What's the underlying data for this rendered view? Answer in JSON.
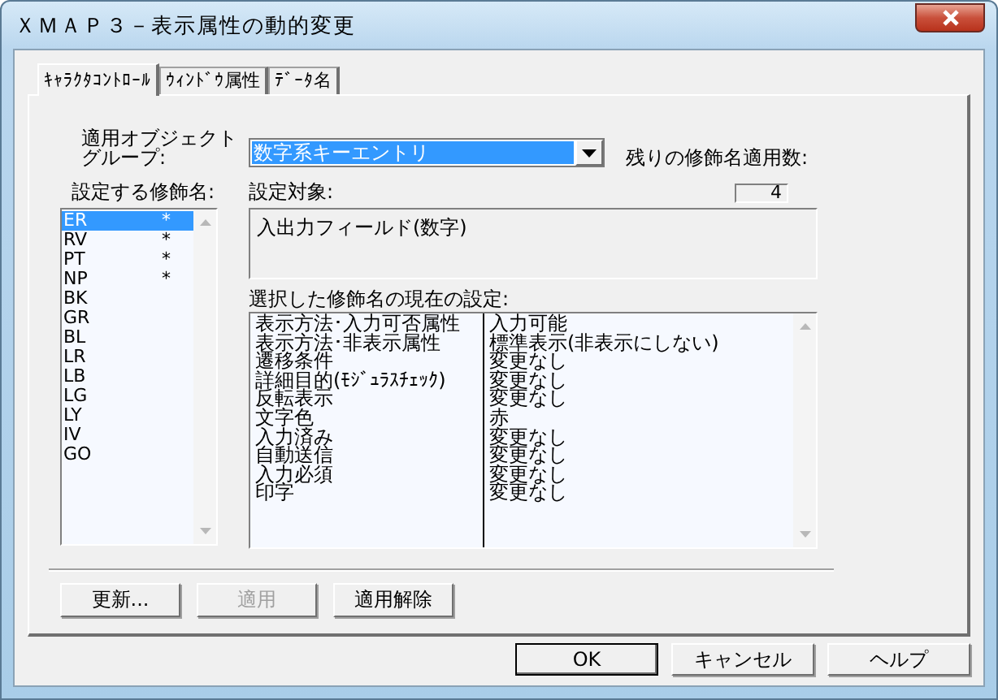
{
  "window": {
    "title": "ＸＭＡＰ３－表示属性の動的変更"
  },
  "tabs": [
    {
      "label": "ｷｬﾗｸﾀｺﾝﾄﾛｰﾙ",
      "selected": true
    },
    {
      "label": "ｳｨﾝﾄﾞｳ属性",
      "selected": false
    },
    {
      "label": "ﾃﾞｰﾀ名",
      "selected": false
    }
  ],
  "object_group": {
    "label": "適用オブジェクトグループ:",
    "value": "数字系キーエントリ"
  },
  "remaining": {
    "label": "残りの修飾名適用数:",
    "value": "4"
  },
  "modifiers": {
    "label": "設定する修飾名:",
    "items": [
      {
        "name": "ER",
        "mark": "*",
        "selected": true
      },
      {
        "name": "RV",
        "mark": "*",
        "selected": false
      },
      {
        "name": "PT",
        "mark": "*",
        "selected": false
      },
      {
        "name": "NP",
        "mark": "*",
        "selected": false
      },
      {
        "name": "BK",
        "selected": false
      },
      {
        "name": "GR",
        "selected": false
      },
      {
        "name": "BL",
        "selected": false
      },
      {
        "name": "LR",
        "selected": false
      },
      {
        "name": "LB",
        "selected": false
      },
      {
        "name": "LG",
        "selected": false
      },
      {
        "name": "LY",
        "selected": false
      },
      {
        "name": "IV",
        "selected": false
      },
      {
        "name": "GO",
        "selected": false
      }
    ]
  },
  "target": {
    "label": "設定対象:",
    "value": "入出力フィールド(数字)"
  },
  "settings": {
    "label": "選択した修飾名の現在の設定:",
    "rows": [
      {
        "name": "表示方法･入力可否属性",
        "value": "入力可能"
      },
      {
        "name": "表示方法･非表示属性",
        "value": "標準表示(非表示にしない)"
      },
      {
        "name": "遷移条件",
        "value": "変更なし"
      },
      {
        "name": "詳細目的(ﾓｼﾞｭﾗｽﾁｪｯｸ)",
        "value": "変更なし"
      },
      {
        "name": "反転表示",
        "value": "変更なし"
      },
      {
        "name": "文字色",
        "value": "赤"
      },
      {
        "name": "入力済み",
        "value": "変更なし"
      },
      {
        "name": "自動送信",
        "value": "変更なし"
      },
      {
        "name": "入力必須",
        "value": "変更なし"
      },
      {
        "name": "印字",
        "value": "変更なし"
      }
    ]
  },
  "actions": [
    {
      "label": "更新...",
      "disabled": false
    },
    {
      "label": "適用",
      "disabled": true
    },
    {
      "label": "適用解除",
      "disabled": false
    }
  ],
  "dialog_buttons": [
    {
      "label": "OK",
      "default": true
    },
    {
      "label": "キャンセル",
      "default": false
    },
    {
      "label": "ヘルプ",
      "default": false
    }
  ]
}
